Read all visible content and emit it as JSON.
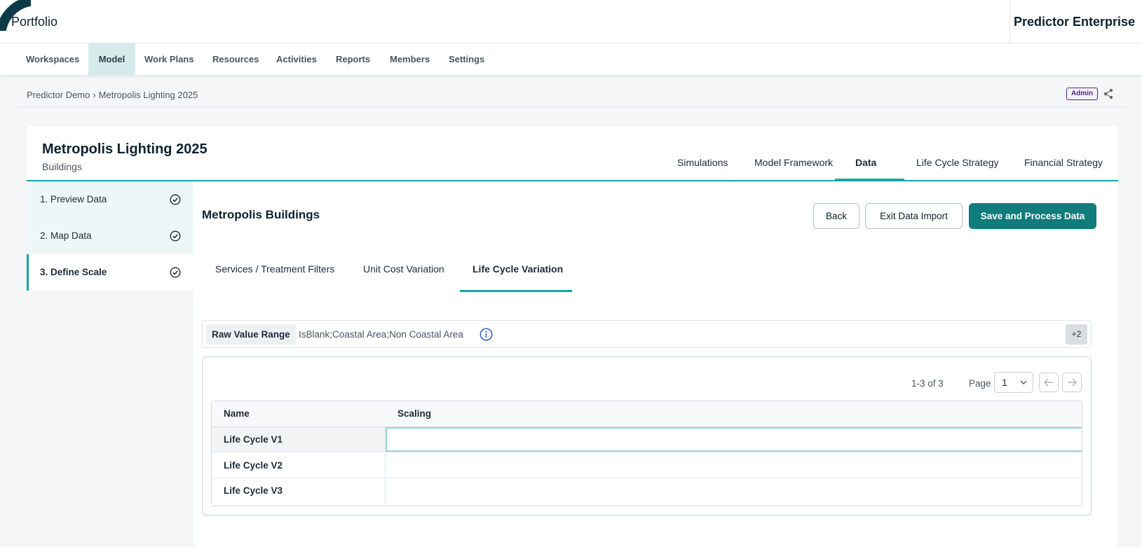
{
  "header": {
    "app_title": "Portfolio",
    "brand": "Predictor Enterprise"
  },
  "nav": {
    "items": [
      {
        "label": "Workspaces",
        "active": false
      },
      {
        "label": "Model",
        "active": true
      },
      {
        "label": "Work Plans",
        "active": false
      },
      {
        "label": "Resources",
        "active": false
      },
      {
        "label": "Activities",
        "active": false
      },
      {
        "label": "Reports",
        "active": false
      },
      {
        "label": "Members",
        "active": false
      },
      {
        "label": "Settings",
        "active": false
      }
    ]
  },
  "breadcrumb": {
    "items": [
      "Predictor Demo",
      "Metropolis Lighting 2025"
    ],
    "role_badge": "Admin",
    "share_icon": "share-icon"
  },
  "project": {
    "title": "Metropolis Lighting 2025",
    "subtitle": "Buildings",
    "tabs": [
      {
        "label": "Simulations",
        "active": false
      },
      {
        "label": "Model Framework",
        "active": false
      },
      {
        "label": "Data",
        "active": true
      },
      {
        "label": "Life Cycle Strategy",
        "active": false
      },
      {
        "label": "Financial Strategy",
        "active": false
      }
    ]
  },
  "steps": [
    {
      "label": "1. Preview Data",
      "active": false,
      "icon": "check-circle-icon"
    },
    {
      "label": "2. Map Data",
      "active": false,
      "icon": "check-circle-icon"
    },
    {
      "label": "3. Define Scale",
      "active": true,
      "icon": "check-circle-icon"
    }
  ],
  "content": {
    "title": "Metropolis Buildings",
    "buttons": {
      "back": "Back",
      "exit": "Exit Data Import",
      "save": "Save and Process Data"
    },
    "sub_tabs": [
      {
        "label": "Services / Treatment Filters",
        "active": false
      },
      {
        "label": "Unit Cost Variation",
        "active": false
      },
      {
        "label": "Life Cycle Variation",
        "active": true
      }
    ],
    "filter": {
      "chip": "Raw Value Range",
      "value": "IsBlank;Coastal Area;Non Coastal Area",
      "more": "+2"
    },
    "pager": {
      "range": "1-3 of 3",
      "page_label": "Page",
      "page_value": "1"
    },
    "table": {
      "columns": [
        "Name",
        "Scaling"
      ],
      "rows": [
        {
          "name": "Life Cycle V1",
          "scaling": ""
        },
        {
          "name": "Life Cycle V2",
          "scaling": ""
        },
        {
          "name": "Life Cycle V3",
          "scaling": ""
        }
      ]
    }
  },
  "colors": {
    "accent": "#19a6a6",
    "primary_button": "#127b7b",
    "nav_active_bg": "#d5ebeb",
    "dark_text": "#0d2230"
  }
}
